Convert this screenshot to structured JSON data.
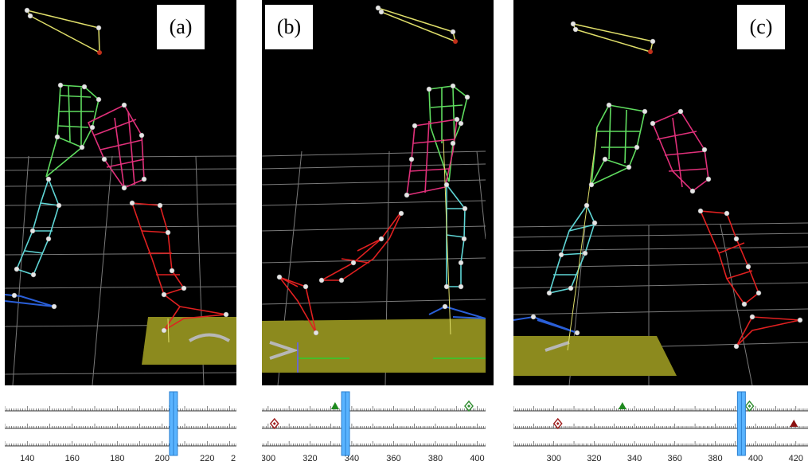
{
  "panels": [
    {
      "id": "a",
      "label": "(a)",
      "timeline": {
        "min": 130,
        "max": 233,
        "ticks": [
          140,
          160,
          180,
          200,
          220
        ],
        "tick_labels": [
          "140",
          "160",
          "180",
          "200",
          "220",
          "2"
        ],
        "playhead": 205,
        "markers": [
          {
            "row": 0,
            "frame": 205,
            "shape": "diamond-outline",
            "color": "#2e8b2e"
          }
        ]
      }
    },
    {
      "id": "b",
      "label": "(b)",
      "timeline": {
        "min": 297,
        "max": 404,
        "ticks": [
          300,
          320,
          340,
          360,
          380,
          400
        ],
        "tick_labels": [
          "300",
          "320",
          "340",
          "360",
          "380",
          "400"
        ],
        "playhead": 337,
        "markers": [
          {
            "row": 0,
            "frame": 332,
            "shape": "triangle",
            "color": "#1f8a1f"
          },
          {
            "row": 0,
            "frame": 396,
            "shape": "diamond-outline",
            "color": "#2e8b2e"
          },
          {
            "row": 1,
            "frame": 303,
            "shape": "diamond-outline",
            "color": "#a02020"
          }
        ]
      }
    },
    {
      "id": "c",
      "label": "(c)",
      "timeline": {
        "min": 280,
        "max": 426,
        "ticks": [
          300,
          320,
          340,
          360,
          380,
          400,
          420
        ],
        "tick_labels": [
          "300",
          "320",
          "340",
          "360",
          "380",
          "400",
          "420"
        ],
        "playhead": 393,
        "markers": [
          {
            "row": 0,
            "frame": 334,
            "shape": "triangle",
            "color": "#1f8a1f"
          },
          {
            "row": 0,
            "frame": 397,
            "shape": "diamond-outline",
            "color": "#2e8b2e"
          },
          {
            "row": 1,
            "frame": 302,
            "shape": "diamond-outline",
            "color": "#a02020"
          },
          {
            "row": 1,
            "frame": 419,
            "shape": "triangle",
            "color": "#8b1010"
          }
        ]
      }
    }
  ],
  "colors": {
    "background": "#000000",
    "grid": "#7a7a7a",
    "floor": "#8c8a1e",
    "head": "#e0df6a",
    "torso_green": "#5fdc5f",
    "arm_magenta": "#e0307a",
    "leg_cyan": "#5fd6d6",
    "leg_red": "#e02020",
    "foot_blue": "#2a5fd8",
    "joint": "#e6e6e6",
    "playhead": "#5ab4ff"
  }
}
